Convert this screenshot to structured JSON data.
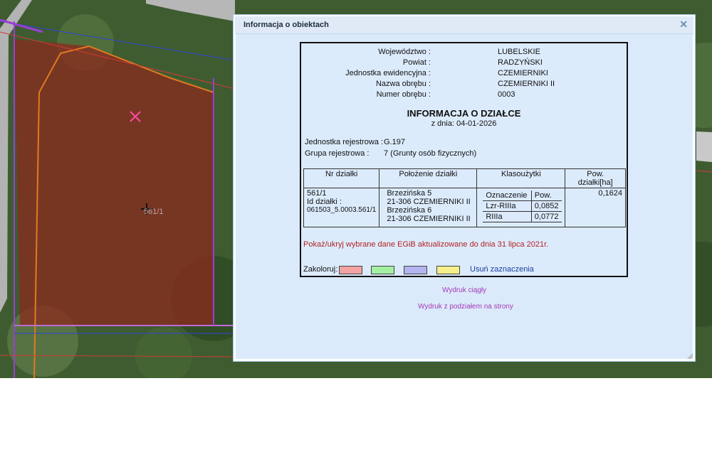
{
  "map": {
    "parcel_label": "561/1",
    "colors": {
      "parcel_fill": "#8b2a1e",
      "boundary": "#9a3fd6",
      "road": "#b9b9b9"
    }
  },
  "dialog": {
    "title": "Informacja o obiektach",
    "close_icon": "close-icon",
    "header": [
      {
        "key": "Województwo :",
        "value": "LUBELSKIE"
      },
      {
        "key": "Powiat :",
        "value": "RADZYŃSKI"
      },
      {
        "key": "Jednostka ewidencyjna :",
        "value": "CZEMIERNIKI"
      },
      {
        "key": "Nazwa obrębu :",
        "value": "CZEMIERNIKI II"
      },
      {
        "key": "Numer obrębu :",
        "value": "0003"
      }
    ],
    "doc_title": "INFORMACJA O DZIAŁCE",
    "doc_date": "z dnia: 04-01-2026",
    "registry": [
      {
        "key": "Jednostka rejestrowa :",
        "value": "G.197"
      },
      {
        "key": "Grupa rejestrowa :",
        "value": "7 (Grunty osób fizycznych)"
      }
    ],
    "table": {
      "headers": [
        "Nr działki",
        "Położenie działki",
        "Klasoużytki",
        "Pow. działki[ha]"
      ],
      "parcel_no": "561/1",
      "parcel_id_label": "Id działki :",
      "parcel_id": "061503_5.0003.561/1",
      "locations": [
        {
          "street": "Brzezińska 5",
          "city": "21-306 CZEMIERNIKI II"
        },
        {
          "street": "Brzezińska 6",
          "city": "21-306 CZEMIERNIKI II"
        }
      ],
      "class_headers": [
        "Oznaczenie",
        "Pow."
      ],
      "classes": [
        {
          "code": "Lzr-RIIIa",
          "area": "0,0852"
        },
        {
          "code": "RIIIa",
          "area": "0,0772"
        }
      ],
      "area": "0,1624"
    },
    "toggle_link": "Pokaż/ukryj wybrane dane EGiB aktualizowane do dnia 31 lipca 2021r.",
    "color_label": "Zakoloruj:",
    "swatches": [
      "#f4a3a3",
      "#a3f0a3",
      "#b4b4f0",
      "#f6f08a"
    ],
    "clear_link": "Usuń zaznaczenia",
    "print_continuous": "Wydruk ciągły",
    "print_pages": "Wydruk z podziałem na strony"
  }
}
